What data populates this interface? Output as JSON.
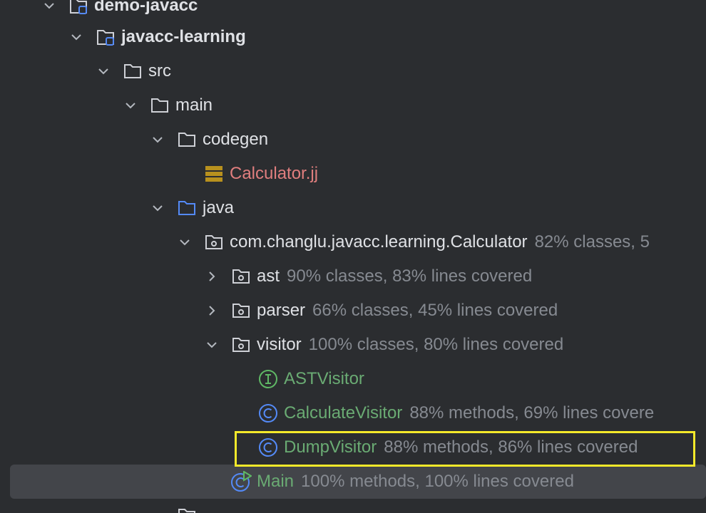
{
  "colors": {
    "background": "#2b2d30",
    "selection": "#43454a",
    "highlight_box": "#f4e92a",
    "text": "#dfe1e5",
    "coverage_text": "#868a91",
    "class_green": "#6aab73",
    "class_icon_blue": "#548af7",
    "interface_icon_green": "#5fb865",
    "grammar_file_red": "#e07e7e",
    "grammar_icon_gold": "#b8911e",
    "source_folder_blue": "#548af7"
  },
  "tree": [
    {
      "name": "demo-javacc",
      "coverage": "",
      "icon": "module-folder-icon",
      "expanded": true
    },
    {
      "name": "javacc-learning",
      "coverage": "",
      "icon": "module-folder-icon",
      "expanded": true
    },
    {
      "name": "src",
      "coverage": "",
      "icon": "folder-icon",
      "expanded": true
    },
    {
      "name": "main",
      "coverage": "",
      "icon": "folder-icon",
      "expanded": true
    },
    {
      "name": "codegen",
      "coverage": "",
      "icon": "folder-icon",
      "expanded": true
    },
    {
      "name": "Calculator.jj",
      "coverage": "",
      "icon": "grammar-file-icon"
    },
    {
      "name": "java",
      "coverage": "",
      "icon": "source-folder-icon",
      "expanded": true
    },
    {
      "name": "com.changlu.javacc.learning.Calculator",
      "coverage": "82% classes, 5",
      "icon": "package-icon",
      "expanded": true
    },
    {
      "name": "ast",
      "coverage": "90% classes, 83% lines covered",
      "icon": "package-icon",
      "expanded": false
    },
    {
      "name": "parser",
      "coverage": "66% classes, 45% lines covered",
      "icon": "package-icon",
      "expanded": false
    },
    {
      "name": "visitor",
      "coverage": "100% classes, 80% lines covered",
      "icon": "package-icon",
      "expanded": true
    },
    {
      "name": "ASTVisitor",
      "coverage": "",
      "icon": "interface-icon"
    },
    {
      "name": "CalculateVisitor",
      "coverage": "88% methods, 69% lines covere",
      "icon": "class-icon"
    },
    {
      "name": "DumpVisitor",
      "coverage": "88% methods, 86% lines covered",
      "icon": "class-icon",
      "highlighted": true
    },
    {
      "name": "Main",
      "coverage": "100% methods, 100% lines covered",
      "icon": "runnable-class-icon",
      "selected": true
    }
  ]
}
